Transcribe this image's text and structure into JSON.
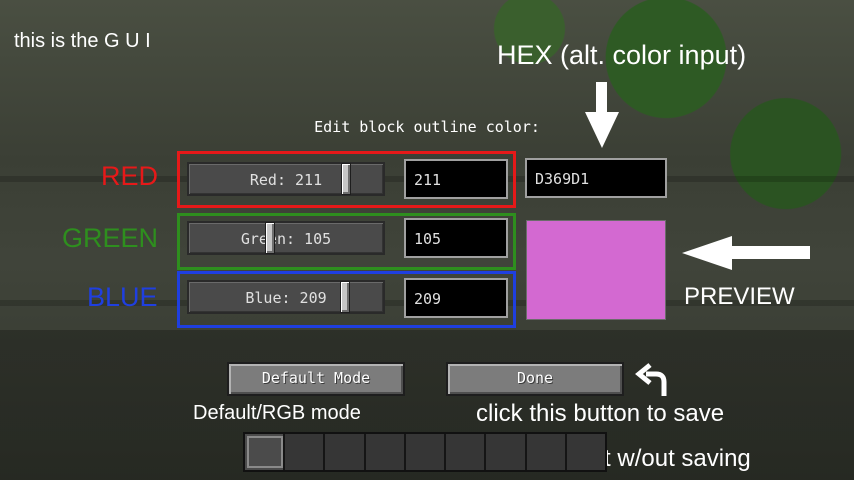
{
  "annotations": {
    "gui_caption": "this is the G U I",
    "hex_caption": "HEX (alt. color input)",
    "red_label": "RED",
    "green_label": "GREEN",
    "blue_label": "BLUE",
    "preview_label": "PREVIEW",
    "default_mode_caption": "Default/RGB mode",
    "save_caption": "click this button to save",
    "esc_caption": "ESC will quit w/out saving"
  },
  "dialog": {
    "title": "Edit block outline color:",
    "sliders": {
      "red": {
        "label": "Red: 211",
        "value": 211,
        "max": 255
      },
      "green": {
        "label": "Green: 105",
        "value": 105,
        "max": 255
      },
      "blue": {
        "label": "Blue: 209",
        "value": 209,
        "max": 255
      }
    },
    "inputs": {
      "red": "211",
      "green": "105",
      "blue": "209",
      "hex": "D369D1"
    },
    "preview_color": "#D369D1",
    "buttons": {
      "default_mode": "Default Mode",
      "done": "Done"
    }
  },
  "hotbar": {
    "slots": 9,
    "selected": 1
  },
  "colors": {
    "red_frame": "#e61919",
    "green_frame": "#2e8f1e",
    "blue_frame": "#1f3fe0"
  }
}
